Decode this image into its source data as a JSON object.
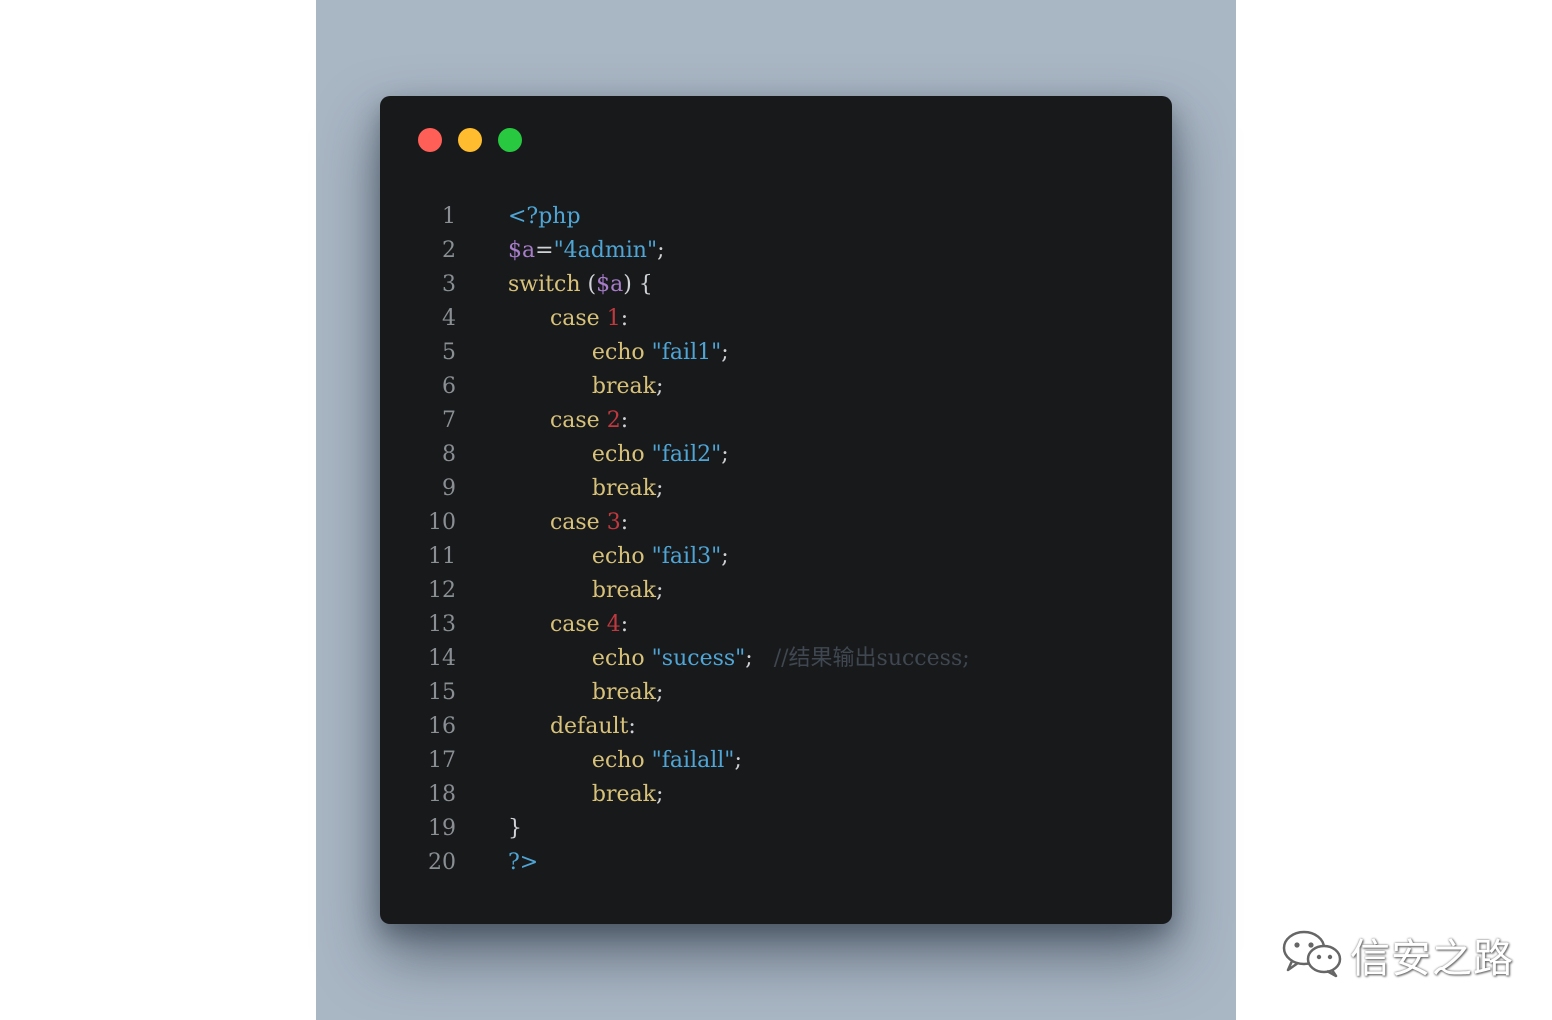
{
  "window": {
    "buttons": [
      "close",
      "minimize",
      "maximize"
    ],
    "colors": {
      "close": "#ff5f57",
      "minimize": "#febc2e",
      "maximize": "#28c840",
      "background": "#18191b",
      "backdrop": "#a9b6c4"
    }
  },
  "code": {
    "language": "php",
    "line_numbers": [
      "1",
      "2",
      "3",
      "4",
      "5",
      "6",
      "7",
      "8",
      "9",
      "10",
      "11",
      "12",
      "13",
      "14",
      "15",
      "16",
      "17",
      "18",
      "19",
      "20"
    ],
    "lines": [
      [
        {
          "t": "<?php",
          "c": "tag"
        }
      ],
      [
        {
          "t": "$a",
          "c": "var"
        },
        {
          "t": "=",
          "c": "punc"
        },
        {
          "t": "\"4admin\"",
          "c": "str"
        },
        {
          "t": ";",
          "c": "punc"
        }
      ],
      [
        {
          "t": "switch",
          "c": "kw"
        },
        {
          "t": " (",
          "c": "punc"
        },
        {
          "t": "$a",
          "c": "var"
        },
        {
          "t": ") {",
          "c": "punc"
        }
      ],
      [
        {
          "t": "      case ",
          "c": "kw"
        },
        {
          "t": "1",
          "c": "num"
        },
        {
          "t": ":",
          "c": "punc"
        }
      ],
      [
        {
          "t": "            echo ",
          "c": "kw"
        },
        {
          "t": "\"fail1\"",
          "c": "str"
        },
        {
          "t": ";",
          "c": "punc"
        }
      ],
      [
        {
          "t": "            break",
          "c": "kw"
        },
        {
          "t": ";",
          "c": "punc"
        }
      ],
      [
        {
          "t": "      case ",
          "c": "kw"
        },
        {
          "t": "2",
          "c": "num"
        },
        {
          "t": ":",
          "c": "punc"
        }
      ],
      [
        {
          "t": "            echo ",
          "c": "kw"
        },
        {
          "t": "\"fail2\"",
          "c": "str"
        },
        {
          "t": ";",
          "c": "punc"
        }
      ],
      [
        {
          "t": "            break",
          "c": "kw"
        },
        {
          "t": ";",
          "c": "punc"
        }
      ],
      [
        {
          "t": "      case ",
          "c": "kw"
        },
        {
          "t": "3",
          "c": "num"
        },
        {
          "t": ":",
          "c": "punc"
        }
      ],
      [
        {
          "t": "            echo ",
          "c": "kw"
        },
        {
          "t": "\"fail3\"",
          "c": "str"
        },
        {
          "t": ";",
          "c": "punc"
        }
      ],
      [
        {
          "t": "            break",
          "c": "kw"
        },
        {
          "t": ";",
          "c": "punc"
        }
      ],
      [
        {
          "t": "      case ",
          "c": "kw"
        },
        {
          "t": "4",
          "c": "num"
        },
        {
          "t": ":",
          "c": "punc"
        }
      ],
      [
        {
          "t": "            echo ",
          "c": "kw"
        },
        {
          "t": "\"sucess\"",
          "c": "str"
        },
        {
          "t": ";   ",
          "c": "punc"
        },
        {
          "t": "//结果输出success;",
          "c": "cmt"
        }
      ],
      [
        {
          "t": "            break",
          "c": "kw"
        },
        {
          "t": ";",
          "c": "punc"
        }
      ],
      [
        {
          "t": "      default",
          "c": "kw"
        },
        {
          "t": ":",
          "c": "punc"
        }
      ],
      [
        {
          "t": "            echo ",
          "c": "kw"
        },
        {
          "t": "\"failall\"",
          "c": "str"
        },
        {
          "t": ";",
          "c": "punc"
        }
      ],
      [
        {
          "t": "            break",
          "c": "kw"
        },
        {
          "t": ";",
          "c": "punc"
        }
      ],
      [
        {
          "t": "}",
          "c": "punc"
        }
      ],
      [
        {
          "t": "?>",
          "c": "tag"
        }
      ]
    ]
  },
  "watermark": {
    "text": "信安之路",
    "icon": "wechat-icon"
  }
}
